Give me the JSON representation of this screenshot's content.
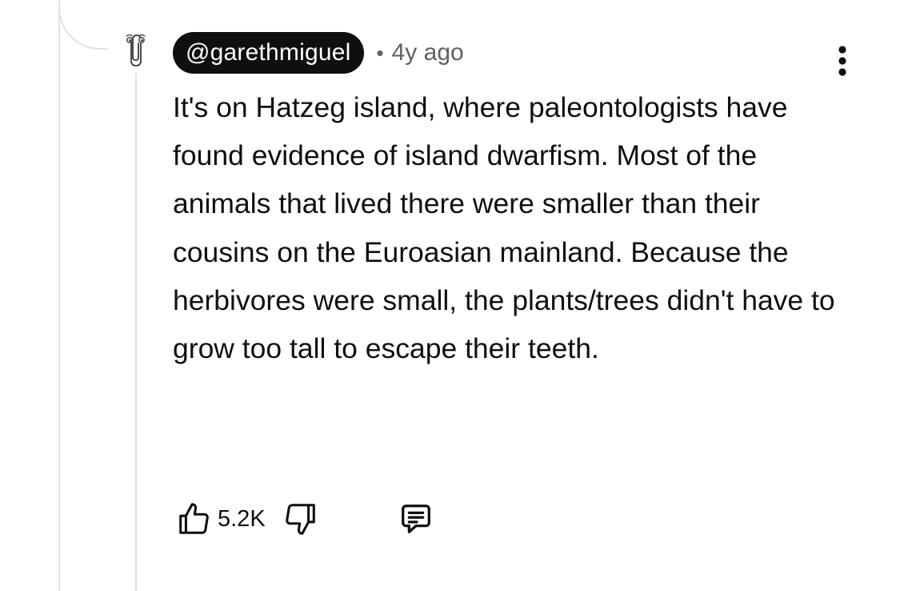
{
  "comment": {
    "author": "@garethmiguel",
    "separator": "•",
    "time": "4y ago",
    "body": "It's on Hatzeg island, where paleontologists have found evidence of island dwarfism. Most of the animals that lived there were smaller than their cousins on the Euroasian mainland. Because the herbivores were small, the plants/trees didn't have to grow too tall to escape their teeth.",
    "likes": "5.2K"
  },
  "icons": {
    "avatar": "clippy-avatar-icon",
    "more": "more-vertical-icon",
    "like": "thumbs-up-icon",
    "dislike": "thumbs-down-icon",
    "reply": "comment-icon"
  },
  "colors": {
    "text": "#0f0f0f",
    "muted": "#606060",
    "handle_bg": "#0f0f0f",
    "handle_text": "#ffffff",
    "thread_line": "#e2e2e2",
    "background": "#ffffff"
  }
}
